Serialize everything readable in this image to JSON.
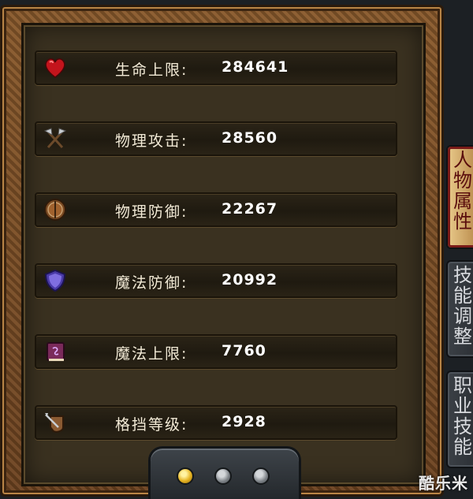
{
  "stats": [
    {
      "label": "生命上限:",
      "value": "284641",
      "icon": "heart-icon"
    },
    {
      "label": "物理攻击:",
      "value": "28560",
      "icon": "axe-icon"
    },
    {
      "label": "物理防御:",
      "value": "22267",
      "icon": "shield-icon"
    },
    {
      "label": "魔法防御:",
      "value": "20992",
      "icon": "magic-shield-icon"
    },
    {
      "label": "魔法上限:",
      "value": "7760",
      "icon": "spellbook-icon"
    },
    {
      "label": "格挡等级:",
      "value": "2928",
      "icon": "block-icon"
    }
  ],
  "tabs": {
    "character_attributes": [
      "人",
      "物",
      "属",
      "性"
    ],
    "skill_adjust": [
      "技",
      "能",
      "调",
      "整"
    ],
    "job_skills": [
      "职",
      "业",
      "技",
      "能"
    ]
  },
  "pager": {
    "active_index": 0,
    "count": 3
  },
  "watermark": "酷乐米",
  "colors": {
    "label": "#f2ead6",
    "value": "#ffffff",
    "frame": "#7a4d24",
    "panel": "#3a3120",
    "active_dot": "#e6b422",
    "active_tab_text": "#5a0d0d"
  }
}
